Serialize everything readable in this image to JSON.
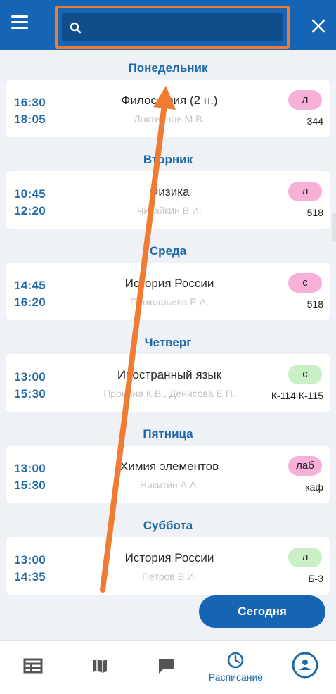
{
  "search": {
    "placeholder": ""
  },
  "days": [
    {
      "name": "Понедельник",
      "start": "16:30",
      "end": "18:05",
      "subject": "Философия (2 н.)",
      "teacher": "Локтионов М.В.",
      "type": "л",
      "type_color": "#f7b1d8",
      "room": "344"
    },
    {
      "name": "Вторник",
      "start": "10:45",
      "end": "12:20",
      "subject": "Физика",
      "teacher": "Читайкин В.И.",
      "type": "л",
      "type_color": "#f7b1d8",
      "room": "518"
    },
    {
      "name": "Среда",
      "start": "14:45",
      "end": "16:20",
      "subject": "История России",
      "teacher": "Прокофьева Е.А.",
      "type": "с",
      "type_color": "#f7b1d8",
      "room": "518"
    },
    {
      "name": "Четверг",
      "start": "13:00",
      "end": "15:30",
      "subject": "Иностранный язык",
      "teacher": "Пронина К.В., Денисова Е.П.",
      "type": "с",
      "type_color": "#c9efc5",
      "room": "К-114 К-115"
    },
    {
      "name": "Пятница",
      "start": "13:00",
      "end": "15:30",
      "subject": "Химия элементов",
      "teacher": "Никитин А.А.",
      "type": "лаб",
      "type_color": "#f7b1d8",
      "room": "каф"
    },
    {
      "name": "Суббота",
      "start": "13:00",
      "end": "14:35",
      "subject": "История России",
      "teacher": "Петров В.И.",
      "type": "л",
      "type_color": "#c9efc5",
      "room": "Б-3"
    }
  ],
  "today_button": "Сегодня",
  "tabs": [
    {
      "icon": "timetable-icon",
      "label": ""
    },
    {
      "icon": "map-icon",
      "label": ""
    },
    {
      "icon": "chat-icon",
      "label": ""
    },
    {
      "icon": "clock-icon",
      "label": "Расписание"
    },
    {
      "icon": "profile-icon",
      "label": ""
    }
  ],
  "colors": {
    "primary": "#1565b4",
    "annotation": "#f07c33",
    "day_title": "#1e6aa9"
  }
}
